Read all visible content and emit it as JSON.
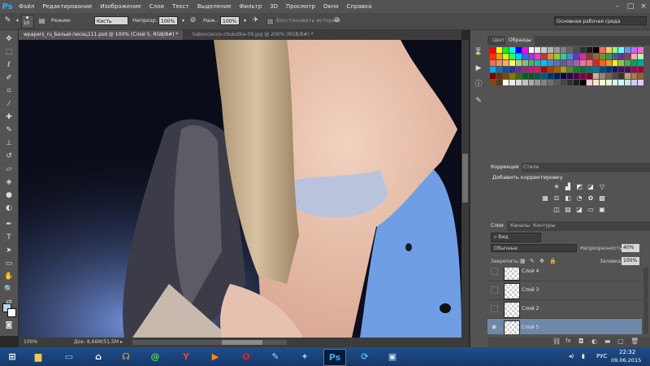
{
  "menubar": {
    "logo": "Ps",
    "items": [
      "Файл",
      "Редактирование",
      "Изображение",
      "Слои",
      "Текст",
      "Выделение",
      "Фильтр",
      "3D",
      "Просмотр",
      "Окно",
      "Справка"
    ],
    "window_controls": [
      "–",
      "□",
      "×"
    ]
  },
  "options": {
    "brush_size": "10",
    "mode_label": "Режим:",
    "mode_value": "Кисть",
    "opacity_label": "Непрозр.:",
    "opacity_value": "100%",
    "pressure_label": "Наж.:",
    "pressure_value": "100%",
    "history_label": "Восстановить историю",
    "workspace": "Основная рабочая среда"
  },
  "tabs": [
    {
      "label": "wpapers_ru_Белый-песец111.psd @ 100% (Слой 5, RGB/8#) *",
      "active": true
    },
    {
      "label": "kabovcenco-chukotka-09.jpg @ 200% (RGB/8#) *",
      "active": false
    }
  ],
  "status": {
    "zoom": "100%",
    "doc": "Док: 8,66M/51,5M"
  },
  "swatch_panel": {
    "tabs": [
      "Цвет",
      "Образцы"
    ],
    "rows": [
      [
        "#ff0000",
        "#ffff00",
        "#00ff00",
        "#00ffff",
        "#0000ff",
        "#ff00ff",
        "#ffffff",
        "#e6e6e6",
        "#cccccc",
        "#b3b3b3",
        "#999999",
        "#808080",
        "#666666",
        "#4d4d4d",
        "#333333",
        "#1a1a1a",
        "#000000",
        "#ff6666",
        "#ffcc66",
        "#99ff66",
        "#66ffff",
        "#6699ff",
        "#cc66ff",
        "#ff66cc"
      ],
      [
        "#ff3300",
        "#ff9900",
        "#ccff00",
        "#33ff66",
        "#00ccff",
        "#3366ff",
        "#9933ff",
        "#ff33cc",
        "#cc3333",
        "#cc9933",
        "#99cc33",
        "#33cc99",
        "#3399cc",
        "#6633cc",
        "#cc3399",
        "#993333",
        "#996633",
        "#669933",
        "#339966",
        "#336699",
        "#663399",
        "#993366",
        "#ffaaaa",
        "#aaffaa"
      ],
      [
        "#f26c4f",
        "#f68e56",
        "#fbaf5d",
        "#fff467",
        "#acd372",
        "#7cc576",
        "#3bb878",
        "#1abbb4",
        "#00bff3",
        "#438cca",
        "#5574b9",
        "#605ca8",
        "#855fa8",
        "#a763a8",
        "#f06ea9",
        "#f26d7d",
        "#ed1c24",
        "#f26522",
        "#f7941d",
        "#fff200",
        "#8dc63f",
        "#39b54a",
        "#00a651",
        "#00a99d"
      ],
      [
        "#00aeef",
        "#0072bc",
        "#0054a6",
        "#2e3192",
        "#662d91",
        "#92278f",
        "#ec008c",
        "#ed145b",
        "#9e0b0f",
        "#a0410d",
        "#a36209",
        "#aba000",
        "#598527",
        "#197b30",
        "#007236",
        "#00746b",
        "#0076a3",
        "#004a80",
        "#003471",
        "#1b1464",
        "#440e62",
        "#630460",
        "#9e005d",
        "#9e0039"
      ],
      [
        "#790000",
        "#7b2e00",
        "#7d4900",
        "#827b00",
        "#406618",
        "#005e20",
        "#005826",
        "#005952",
        "#005b7f",
        "#003663",
        "#002157",
        "#0d004c",
        "#32004b",
        "#4b0049",
        "#7b0046",
        "#7a0026",
        "#c7b299",
        "#998675",
        "#736357",
        "#534741",
        "#37302a",
        "#c69c6d",
        "#a67c52",
        "#8c6239"
      ],
      [
        "#754c24",
        "#603913",
        "#ffffff",
        "#ebebeb",
        "#d7d7d7",
        "#c2c2c2",
        "#acacac",
        "#989898",
        "#838383",
        "#6f6f6f",
        "#5b5b5b",
        "#464646",
        "#333333",
        "#1e1e1e",
        "#000000",
        "#ffcccc",
        "#ffe5cc",
        "#ffffcc",
        "#e5ffcc",
        "#ccffe5",
        "#ccffff",
        "#cce5ff",
        "#ccccff",
        "#e5ccff"
      ]
    ]
  },
  "adjustments": {
    "tabs": [
      "Коррекция",
      "Стили"
    ],
    "heading": "Добавить корректировку"
  },
  "layers_panel": {
    "tabs": [
      "Слои",
      "Каналы",
      "Контуры"
    ],
    "kind_filter": "Вид",
    "blend_mode": "Обычные",
    "opacity_label": "Непрозрачность:",
    "opacity_value": "40%",
    "lock_label": "Закрепить:",
    "fill_label": "Заливка:",
    "fill_value": "100%",
    "layers": [
      {
        "name": "Слой 4",
        "visible": false,
        "selected": false
      },
      {
        "name": "Слой 3",
        "visible": false,
        "selected": false
      },
      {
        "name": "Слой 2",
        "visible": false,
        "selected": false
      },
      {
        "name": "Слой 5",
        "visible": true,
        "selected": true
      }
    ]
  },
  "taskbar": {
    "lang": "РУС",
    "time": "22:32",
    "date": "09.06.2015"
  }
}
